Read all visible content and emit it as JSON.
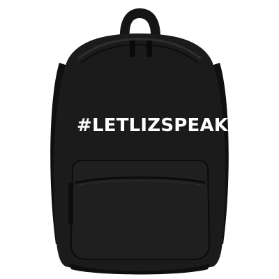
{
  "product": {
    "print_text": "#LETLIZSPEAK"
  },
  "colors": {
    "background": "#ffffff",
    "bag_body": "#1b1b1b",
    "bag_shadow": "#0e0e0e",
    "print": "#ffffff"
  }
}
